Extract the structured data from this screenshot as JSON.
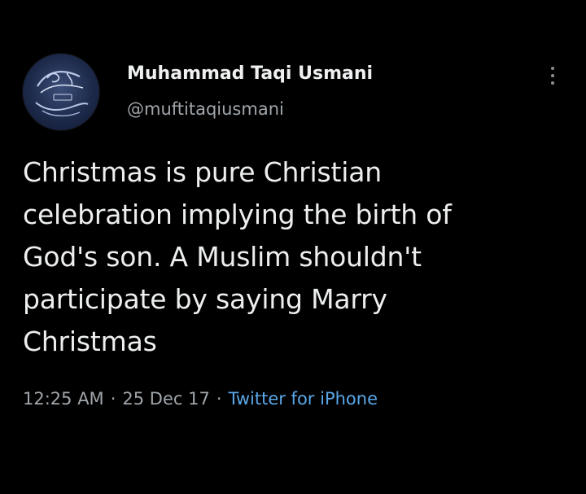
{
  "author": {
    "display_name": "Muhammad Taqi Usmani",
    "handle": "@muftitaqiusmani",
    "avatar_icon": "calligraphy-logo-avatar"
  },
  "tweet": {
    "text_lines": [
      "Christmas is pure Christian",
      "celebration implying the birth of",
      "God's son. A Muslim shouldn't",
      "participate by saying Marry",
      "Christmas"
    ],
    "time": "12:25 AM",
    "date": "25 Dec 17",
    "source": "Twitter for iPhone",
    "separator": "·"
  },
  "menu": {
    "icon": "more-vertical-icon"
  },
  "colors": {
    "background": "#000000",
    "text": "#eceeef",
    "secondary_text": "#a0a6ab",
    "link": "#5aa7e8"
  }
}
